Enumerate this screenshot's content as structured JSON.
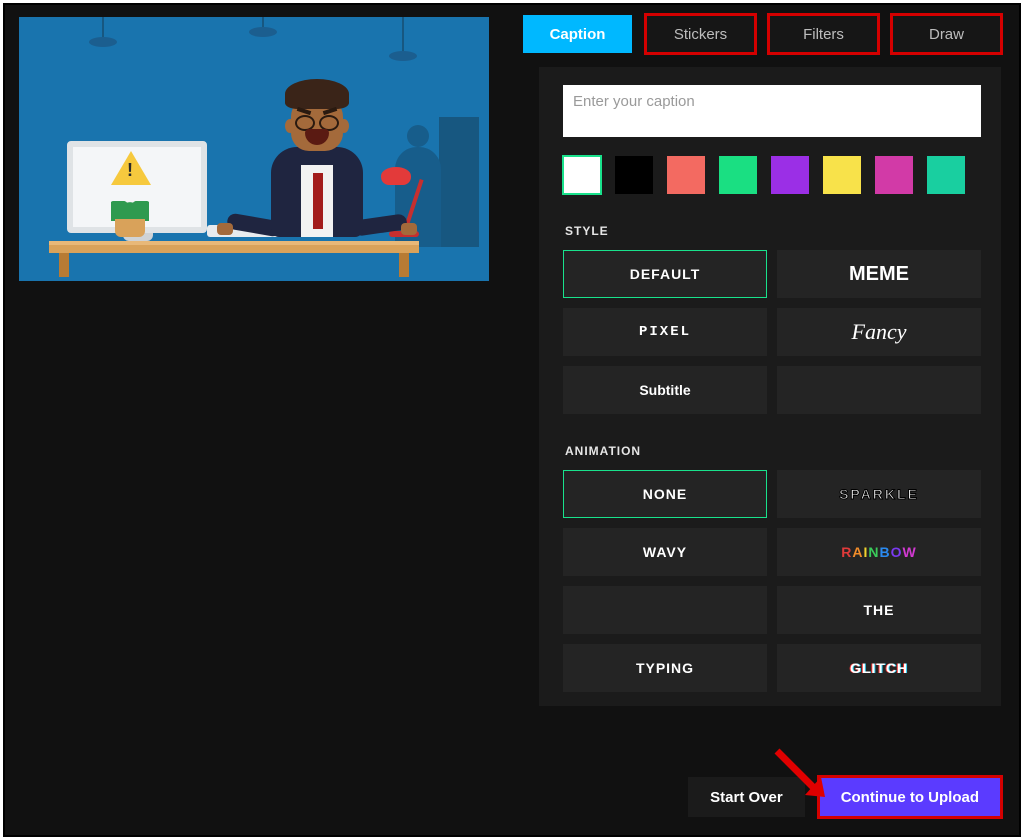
{
  "tabs": {
    "caption": "Caption",
    "stickers": "Stickers",
    "filters": "Filters",
    "draw": "Draw"
  },
  "caption_input": {
    "placeholder": "Enter your caption",
    "value": ""
  },
  "swatches": [
    {
      "name": "white",
      "hex": "#ffffff",
      "selected": true
    },
    {
      "name": "black",
      "hex": "#000000"
    },
    {
      "name": "coral",
      "hex": "#f36a61"
    },
    {
      "name": "green",
      "hex": "#1adf82"
    },
    {
      "name": "purple",
      "hex": "#9b2fe6"
    },
    {
      "name": "yellow",
      "hex": "#f8e24a"
    },
    {
      "name": "magenta",
      "hex": "#d23aa7"
    },
    {
      "name": "teal",
      "hex": "#19cfa0"
    }
  ],
  "sections": {
    "style_label": "STYLE",
    "animation_label": "ANIMATION"
  },
  "style_options": [
    {
      "key": "default",
      "label": "DEFAULT",
      "selected": true
    },
    {
      "key": "meme",
      "label": "MEME"
    },
    {
      "key": "pixel",
      "label": "PIXEL"
    },
    {
      "key": "fancy",
      "label": "Fancy"
    },
    {
      "key": "subtitle",
      "label": "Subtitle"
    },
    {
      "key": "blank",
      "label": ""
    }
  ],
  "animation_options": [
    {
      "key": "none",
      "label": "NONE",
      "selected": true
    },
    {
      "key": "sparkle",
      "label": "SPARKLE"
    },
    {
      "key": "wavy",
      "label": "WAVY"
    },
    {
      "key": "rainbow",
      "label": "RAINBOW"
    },
    {
      "key": "blank",
      "label": ""
    },
    {
      "key": "the",
      "label": "THE"
    },
    {
      "key": "typing",
      "label": "TYPING"
    },
    {
      "key": "glitch",
      "label": "GLITCH"
    }
  ],
  "footer": {
    "start_over": "Start Over",
    "continue": "Continue to Upload"
  },
  "preview": {
    "warning_mark": "!"
  }
}
